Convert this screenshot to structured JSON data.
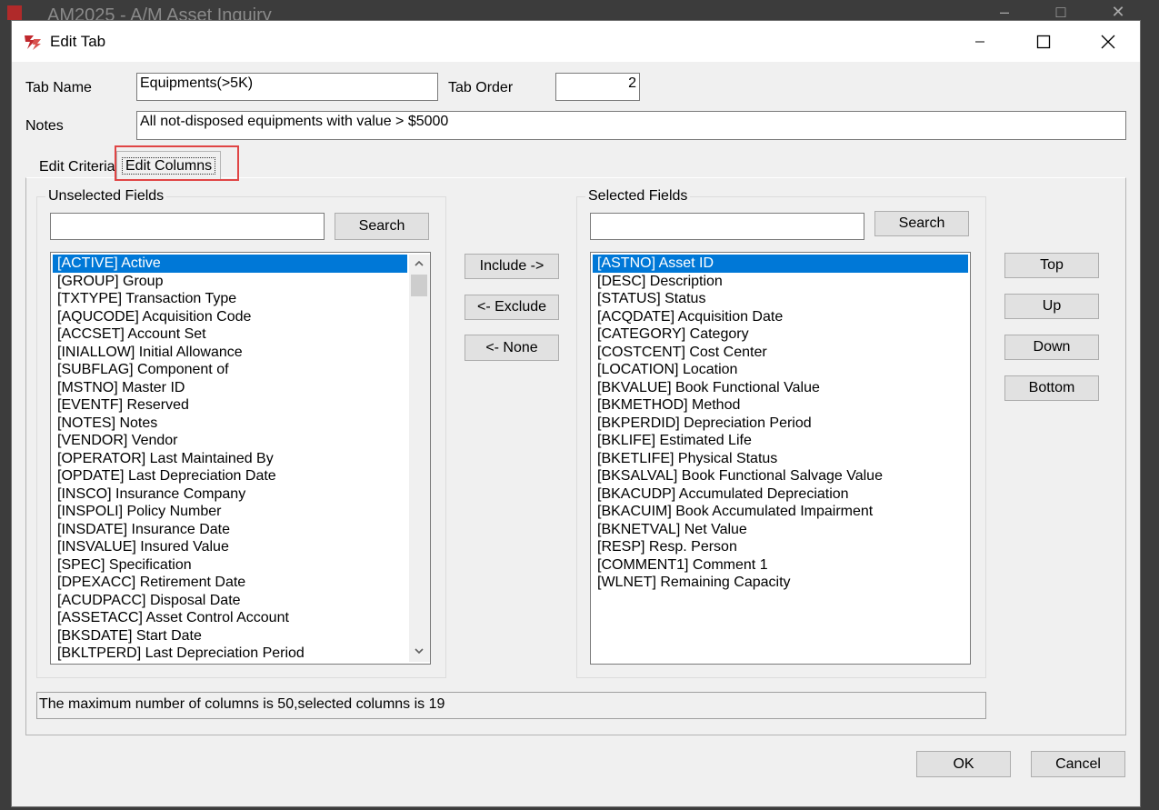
{
  "background_window": {
    "title": "AM2025 - A/M Asset Inquiry"
  },
  "dialog": {
    "title": "Edit Tab",
    "tab_name_label": "Tab Name",
    "tab_name_value": "Equipments(>5K)",
    "tab_order_label": "Tab Order",
    "tab_order_value": "2",
    "notes_label": "Notes",
    "notes_value": "All not-disposed equipments with value > $5000",
    "tabs": [
      {
        "label": "Edit Criteria",
        "active": false
      },
      {
        "label": "Edit Columns",
        "active": true
      }
    ],
    "unselected": {
      "group_label": "Unselected Fields",
      "search_value": "",
      "search_button": "Search",
      "items": [
        "[ACTIVE] Active",
        "[GROUP] Group",
        "[TXTYPE] Transaction Type",
        "[AQUCODE] Acquisition Code",
        "[ACCSET] Account Set",
        "[INIALLOW] Initial Allowance",
        "[SUBFLAG] Component of",
        "[MSTNO] Master ID",
        "[EVENTF] Reserved",
        "[NOTES] Notes",
        "[VENDOR] Vendor",
        "[OPERATOR] Last Maintained By",
        "[OPDATE] Last Depreciation Date",
        "[INSCO] Insurance Company",
        "[INSPOLI] Policy Number",
        "[INSDATE] Insurance Date",
        "[INSVALUE] Insured Value",
        "[SPEC] Specification",
        "[DPEXACC] Retirement Date",
        "[ACUDPACC] Disposal Date",
        "[ASSETACC] Asset Control Account",
        "[BKSDATE] Start Date",
        "[BKLTPERD] Last Depreciation Period"
      ],
      "selected_index": 0
    },
    "selected": {
      "group_label": "Selected Fields",
      "search_value": "",
      "search_button": "Search",
      "items": [
        "[ASTNO] Asset ID",
        "[DESC] Description",
        "[STATUS] Status",
        "[ACQDATE] Acquisition Date",
        "[CATEGORY] Category",
        "[COSTCENT] Cost Center",
        "[LOCATION] Location",
        "[BKVALUE] Book Functional Value",
        "[BKMETHOD] Method",
        "[BKPERDID] Depreciation Period",
        "[BKLIFE] Estimated Life",
        "[BKETLIFE] Physical Status",
        "[BKSALVAL] Book Functional Salvage Value",
        "[BKACUDP] Accumulated Depreciation",
        "[BKACUIM] Book Accumulated Impairment",
        "[BKNETVAL] Net Value",
        "[RESP] Resp. Person",
        "[COMMENT1] Comment 1",
        "[WLNET] Remaining Capacity"
      ],
      "selected_index": 0
    },
    "middle_buttons": {
      "include": "Include ->",
      "exclude": "<- Exclude",
      "none": "<- None"
    },
    "order_buttons": {
      "top": "Top",
      "up": "Up",
      "down": "Down",
      "bottom": "Bottom"
    },
    "status_text": "The maximum number of columns is 50,selected columns is 19",
    "ok": "OK",
    "cancel": "Cancel"
  },
  "colors": {
    "selection": "#0078d7",
    "highlight_box": "#e04545",
    "dialog_bg": "#f0f0f0"
  },
  "icons": [
    "app-icon",
    "minimize-icon",
    "maximize-icon",
    "close-icon",
    "scroll-up-icon",
    "scroll-down-icon"
  ]
}
